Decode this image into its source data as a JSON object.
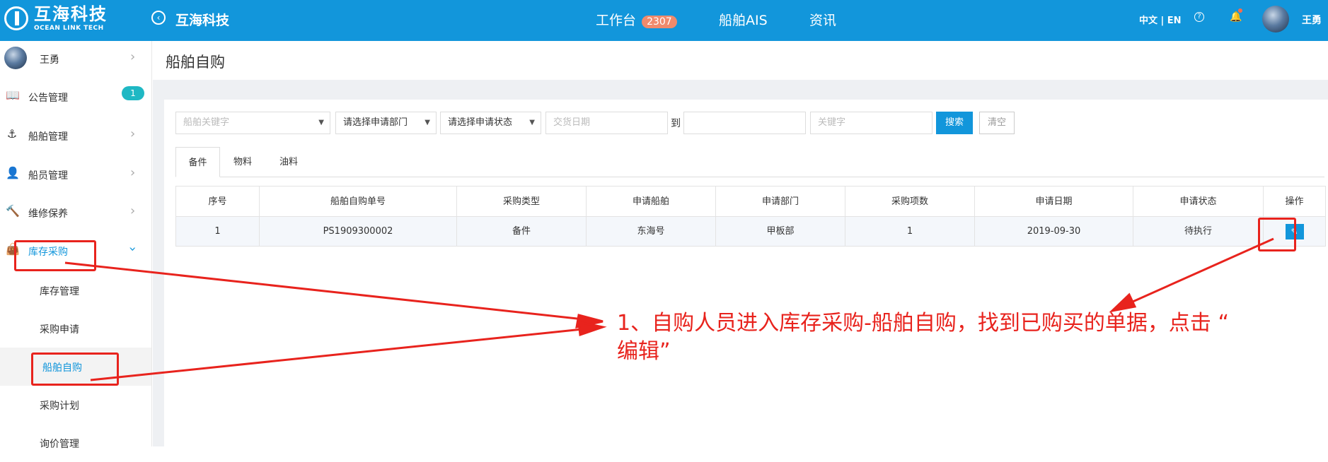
{
  "header": {
    "logo_cn": "互海科技",
    "logo_en": "OCEAN LINK TECH",
    "app_title": "互海科技",
    "nav": [
      {
        "label": "工作台",
        "badge": "2307"
      },
      {
        "label": "船舶AIS"
      },
      {
        "label": "资讯"
      }
    ],
    "lang": "中文 | EN",
    "user": "王勇",
    "icons": [
      "back-circle-icon",
      "help-icon",
      "bell-icon"
    ]
  },
  "sidebar": {
    "user": "王勇",
    "items": [
      {
        "label": "公告管理",
        "icon": "book-icon",
        "badge": "1"
      },
      {
        "label": "船舶管理",
        "icon": "anchor-icon"
      },
      {
        "label": "船员管理",
        "icon": "person-icon"
      },
      {
        "label": "维修保养",
        "icon": "hammer-icon"
      },
      {
        "label": "库存采购",
        "icon": "bag-icon",
        "expanded": true
      }
    ],
    "sub_items": [
      {
        "label": "库存管理"
      },
      {
        "label": "采购申请"
      },
      {
        "label": "船舶自购",
        "active": true
      },
      {
        "label": "采购计划"
      },
      {
        "label": "询价管理"
      }
    ]
  },
  "page": {
    "title": "船舶自购",
    "filters": {
      "ship_placeholder": "船舶关键字",
      "dept_select": "请选择申请部门",
      "status_select": "请选择申请状态",
      "date_start_placeholder": "交货日期",
      "to_label": "到",
      "keyword_placeholder": "关键字",
      "search_label": "搜索",
      "clear_label": "清空"
    },
    "tabs": [
      {
        "label": "备件",
        "active": true
      },
      {
        "label": "物料"
      },
      {
        "label": "油料"
      }
    ],
    "table": {
      "headers": [
        "序号",
        "船舶自购单号",
        "采购类型",
        "申请船舶",
        "申请部门",
        "采购项数",
        "申请日期",
        "申请状态",
        "操作"
      ],
      "rows": [
        [
          "1",
          "PS1909300002",
          "备件",
          "东海号",
          "甲板部",
          "1",
          "2019-09-30",
          "待执行",
          "edit-icon"
        ]
      ]
    }
  },
  "annotation": {
    "line1": "1、自购人员进入库存采购-船舶自购，找到已购买的单据，点击 “",
    "line2": "编辑”",
    "color": "#e8231d"
  },
  "colors": {
    "brand": "#1296db",
    "badge": "#f08a6c",
    "side_badge": "#1fb8c4"
  }
}
